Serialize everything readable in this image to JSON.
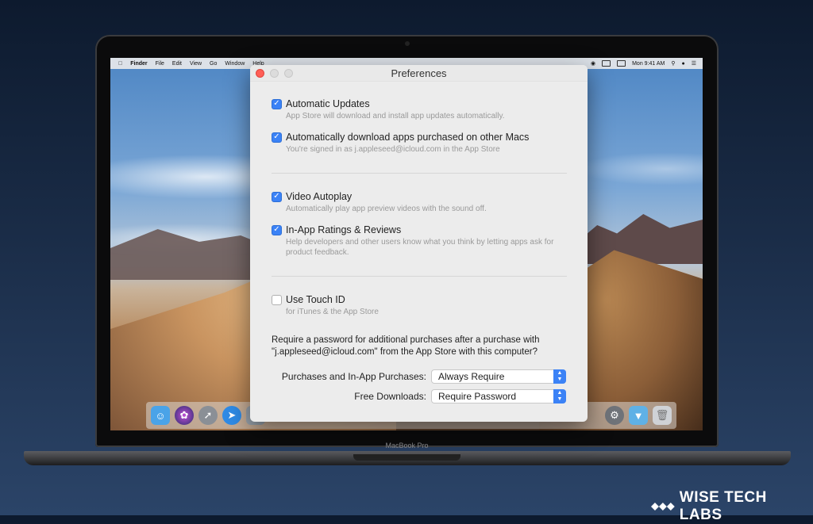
{
  "menubar": {
    "app": "Finder",
    "items": [
      "File",
      "Edit",
      "View",
      "Go",
      "Window",
      "Help"
    ],
    "clock": "Mon 9:41 AM"
  },
  "laptop_label": "MacBook Pro",
  "window": {
    "title": "Preferences",
    "options": [
      {
        "label": "Automatic Updates",
        "checked": true,
        "desc": "App Store will download and install app updates automatically."
      },
      {
        "label": "Automatically download apps purchased on other Macs",
        "checked": true,
        "desc": "You're signed in as j.appleseed@icloud.com in the App Store"
      },
      {
        "label": "Video Autoplay",
        "checked": true,
        "desc": "Automatically play app preview videos with the sound off."
      },
      {
        "label": "In-App Ratings & Reviews",
        "checked": true,
        "desc": "Help developers and other users know what you think by letting apps ask for product feedback."
      },
      {
        "label": "Use Touch ID",
        "checked": false,
        "desc": "for iTunes & the App Store"
      }
    ],
    "password_prompt": "Require a password for additional purchases after a purchase with \"j.appleseed@icloud.com\" from the App Store with this computer?",
    "purchases_label": "Purchases and In-App Purchases:",
    "purchases_value": "Always Require",
    "free_downloads_label": "Free Downloads:",
    "free_downloads_value": "Require Password"
  },
  "brand": "WISE TECH LABS",
  "colors": {
    "accent": "#3b82f6",
    "close": "#ff5f57"
  }
}
